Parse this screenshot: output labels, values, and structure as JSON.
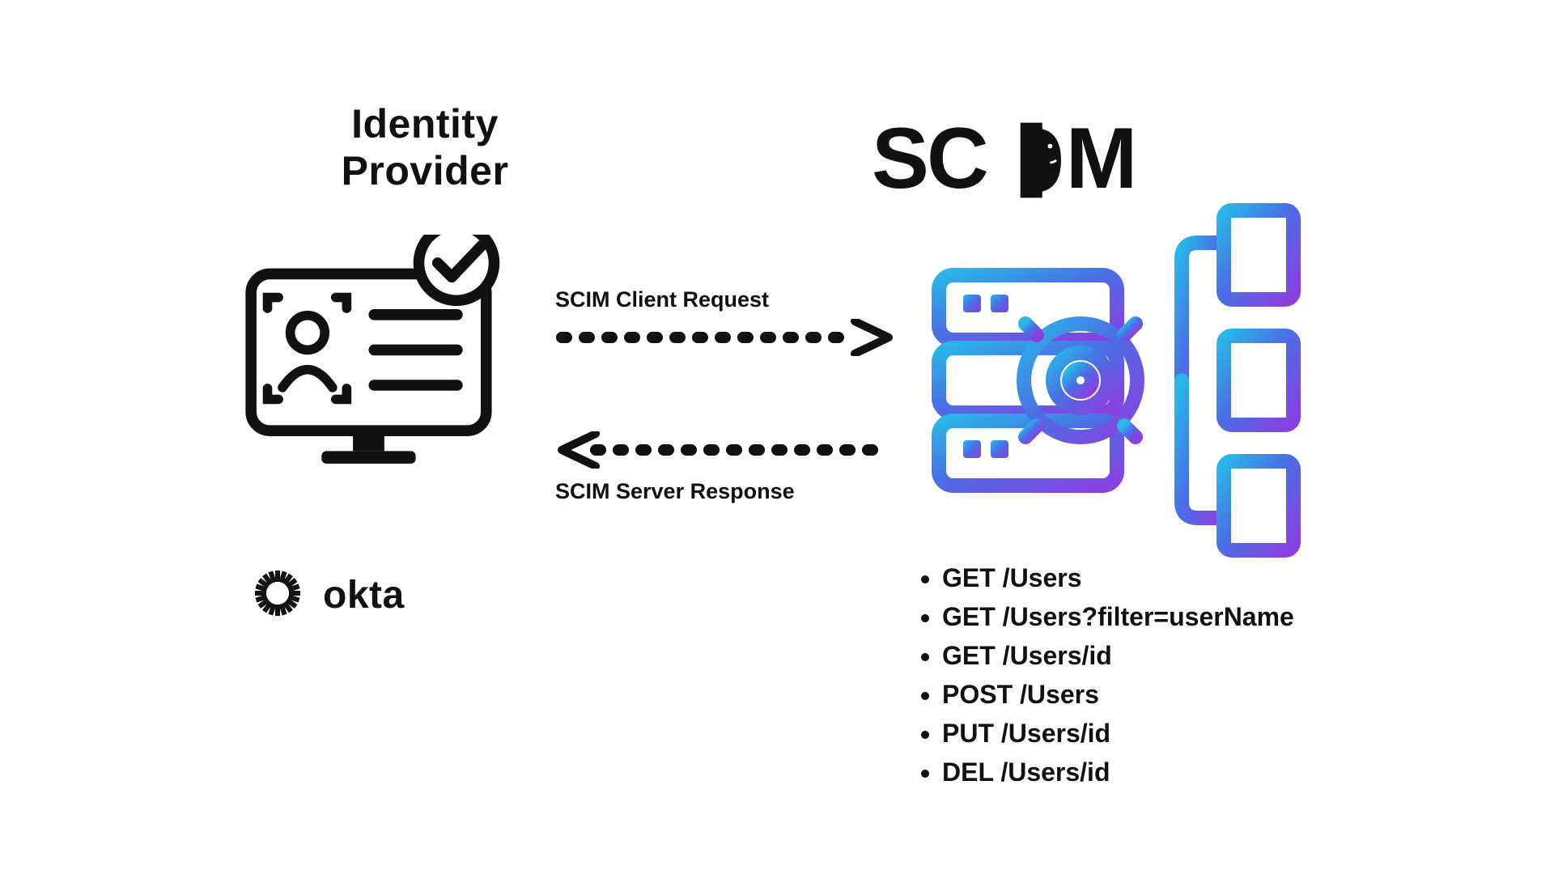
{
  "left": {
    "title": "Identity Provider",
    "brand_name": "okta"
  },
  "arrows": {
    "request_label": "SCIM Client Request",
    "response_label": "SCIM Server Response"
  },
  "right": {
    "title": "SCIM",
    "endpoints": [
      "GET /Users",
      "GET /Users?filter=userName",
      "GET /Users/id",
      "POST /Users",
      "PUT /Users/id",
      "DEL /Users/id"
    ]
  }
}
